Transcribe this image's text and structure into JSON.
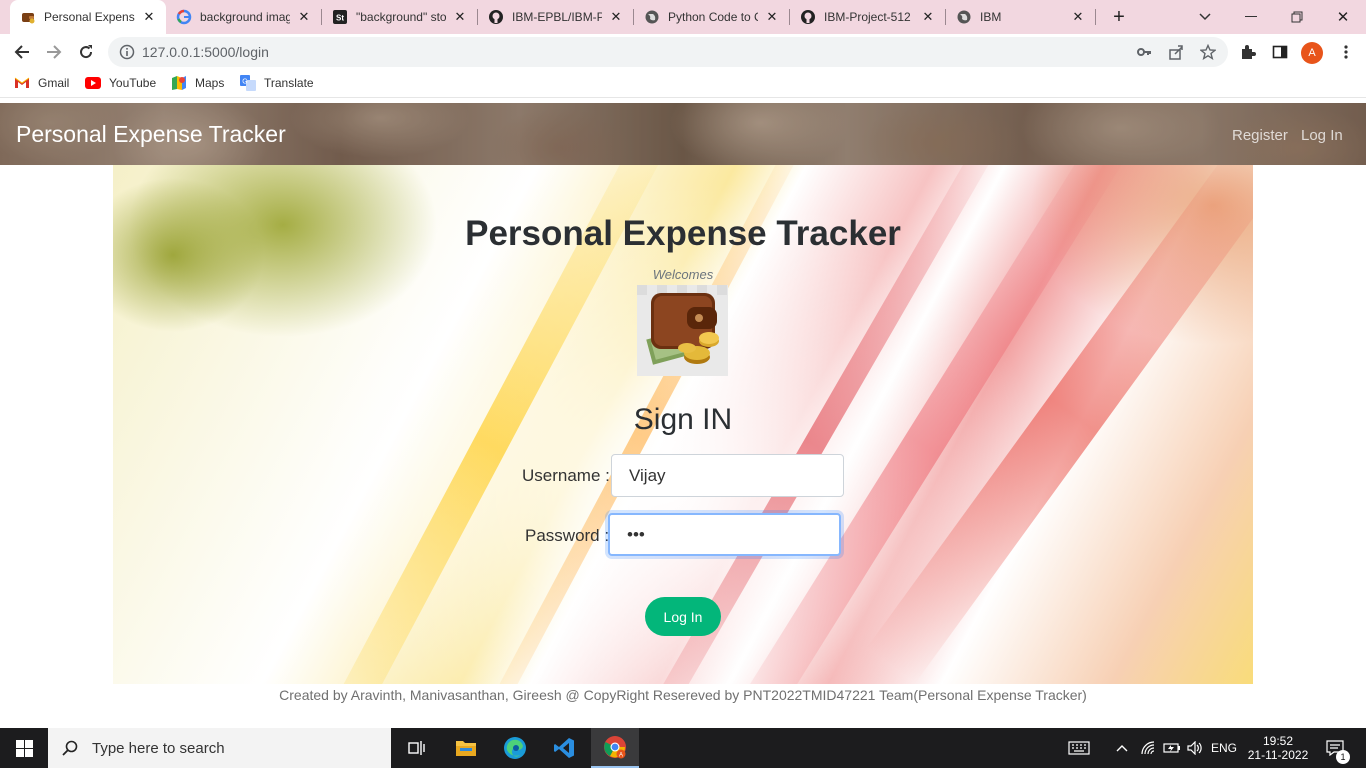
{
  "browser": {
    "tabs": [
      {
        "title": "Personal Expense",
        "icon": "wallet-favicon",
        "active": true
      },
      {
        "title": "background imag",
        "icon": "google-icon",
        "active": false
      },
      {
        "title": "\"background\" sto",
        "icon": "st-icon",
        "active": false
      },
      {
        "title": "IBM-EPBL/IBM-P",
        "icon": "github-icon",
        "active": false
      },
      {
        "title": "Python Code to C",
        "icon": "globe-icon",
        "active": false
      },
      {
        "title": "IBM-Project-512",
        "icon": "github-icon",
        "active": false
      },
      {
        "title": "IBM",
        "icon": "globe-icon",
        "active": false
      }
    ],
    "url": "127.0.0.1:5000/login",
    "profile_initial": "A",
    "bookmarks": [
      {
        "label": "Gmail",
        "icon": "gmail-icon"
      },
      {
        "label": "YouTube",
        "icon": "youtube-icon"
      },
      {
        "label": "Maps",
        "icon": "maps-icon"
      },
      {
        "label": "Translate",
        "icon": "translate-icon"
      }
    ]
  },
  "page": {
    "navbar": {
      "brand": "Personal Expense Tracker",
      "links": [
        "Register",
        "Log In"
      ]
    },
    "hero": {
      "title": "Personal Expense Tracker",
      "welcome": "Welcomes",
      "signin_heading": "Sign IN",
      "username_label": "Username :",
      "username_value": "Vijay",
      "password_label": "Password :",
      "password_value": "•••",
      "login_button": "Log In"
    },
    "footer": "Created by Aravinth, Manivasanthan, Gireesh @ CopyRight Resereved by PNT2022TMID47221 Team(Personal Expense Tracker)"
  },
  "taskbar": {
    "search_placeholder": "Type here to search",
    "language": "ENG",
    "time": "19:52",
    "date": "21-11-2022",
    "notification_count": "1"
  },
  "colors": {
    "tabstrip": "#f2d7e0",
    "login_button": "#03b67a",
    "profile": "#e8541a"
  }
}
